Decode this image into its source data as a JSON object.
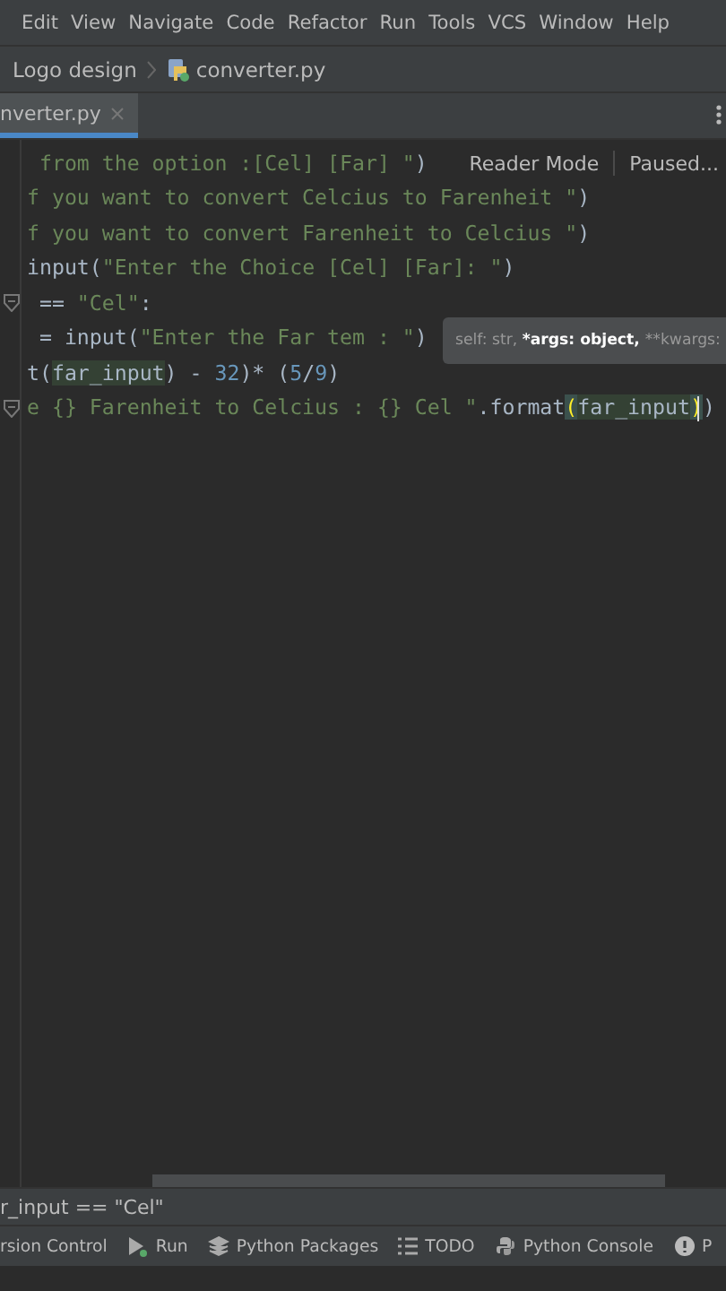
{
  "menu": [
    "Edit",
    "View",
    "Navigate",
    "Code",
    "Refactor",
    "Run",
    "Tools",
    "VCS",
    "Window",
    "Help"
  ],
  "breadcrumb": [
    "Logo design",
    "converter.py"
  ],
  "tabs": [
    {
      "label": "nverter.py",
      "selected": true
    }
  ],
  "reader": {
    "mode": "Reader Mode",
    "status": "Paused..."
  },
  "code_lines": [
    {
      "fold": false,
      "segments": [
        {
          "kind": "string",
          "text": " from the option :[Cel] [Far] \""
        },
        {
          "kind": "plain",
          "text": ")"
        }
      ]
    },
    {
      "fold": false,
      "segments": [
        {
          "kind": "string",
          "text": "f you want to convert Celcius to Farenheit \""
        },
        {
          "kind": "plain",
          "text": ")"
        }
      ]
    },
    {
      "fold": false,
      "segments": [
        {
          "kind": "string",
          "text": "f you want to convert Farenheit to Celcius \""
        },
        {
          "kind": "plain",
          "text": ")"
        }
      ]
    },
    {
      "fold": false,
      "segments": [
        {
          "kind": "plain",
          "text": "input("
        },
        {
          "kind": "string",
          "text": "\"Enter the Choice [Cel] [Far]: \""
        },
        {
          "kind": "plain",
          "text": ")"
        }
      ]
    },
    {
      "fold": true,
      "segments": [
        {
          "kind": "plain",
          "text": " == "
        },
        {
          "kind": "string",
          "text": "\"Cel\""
        },
        {
          "kind": "plain",
          "text": ":"
        }
      ]
    },
    {
      "fold": false,
      "segments": [
        {
          "kind": "plain",
          "text": " = input("
        },
        {
          "kind": "string",
          "text": "\"Enter the Far tem : \""
        },
        {
          "kind": "plain",
          "text": ")"
        }
      ]
    },
    {
      "fold": false,
      "segments": [
        {
          "kind": "plain",
          "text": "t("
        },
        {
          "kind": "highlight",
          "text": "far_input"
        },
        {
          "kind": "plain",
          "text": ") - "
        },
        {
          "kind": "number",
          "text": "32"
        },
        {
          "kind": "plain",
          "text": ")* ("
        },
        {
          "kind": "number",
          "text": "5"
        },
        {
          "kind": "plain",
          "text": "/"
        },
        {
          "kind": "number",
          "text": "9"
        },
        {
          "kind": "plain",
          "text": ")"
        }
      ]
    },
    {
      "fold": true,
      "segments": [
        {
          "kind": "string",
          "text": "e {} Farenheit to Celcius : {} Cel \""
        },
        {
          "kind": "plain",
          "text": ".format"
        },
        {
          "kind": "brace",
          "text": "("
        },
        {
          "kind": "highlight",
          "text": "far_input"
        },
        {
          "kind": "brace",
          "text": ")"
        },
        {
          "kind": "plain",
          "text": ")"
        }
      ]
    }
  ],
  "tooltip": [
    {
      "kind": "dim",
      "text": "self: str, "
    },
    {
      "kind": "bold",
      "text": "*args: object, "
    },
    {
      "kind": "dim",
      "text": "**kwargs:"
    }
  ],
  "status_breadcrumb": "r_input == \"Cel\"",
  "tool_windows": [
    "rsion Control",
    "Run",
    "Python Packages",
    "TODO",
    "Python Console",
    "P"
  ]
}
